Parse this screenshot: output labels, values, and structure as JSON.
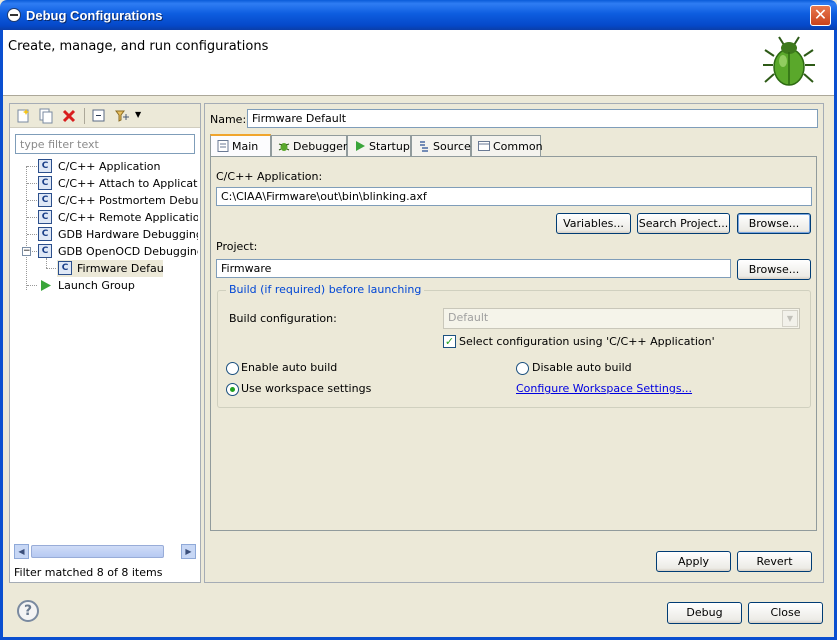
{
  "window": {
    "title": "Debug Configurations"
  },
  "header": {
    "heading": "Create, manage, and run configurations"
  },
  "left": {
    "filter_placeholder": "type filter text",
    "tree": [
      {
        "label": "C/C++ Application"
      },
      {
        "label": "C/C++ Attach to Application"
      },
      {
        "label": "C/C++ Postmortem Debugger"
      },
      {
        "label": "C/C++ Remote Application"
      },
      {
        "label": "GDB Hardware Debugging"
      },
      {
        "label": "GDB OpenOCD Debugging"
      },
      {
        "label": "Firmware Default"
      },
      {
        "label": "Launch Group"
      }
    ],
    "status": "Filter matched 8 of 8 items"
  },
  "config": {
    "name_label": "Name:",
    "name_value": "Firmware Default",
    "tabs": [
      {
        "label": "Main",
        "icon": "main-tab-icon"
      },
      {
        "label": "Debugger",
        "icon": "debugger-bug-icon"
      },
      {
        "label": "Startup",
        "icon": "startup-play-icon"
      },
      {
        "label": "Source",
        "icon": "source-icon"
      },
      {
        "label": "Common",
        "icon": "common-icon"
      }
    ],
    "app_label": "C/C++ Application:",
    "app_value": "C:\\CIAA\\Firmware\\out\\bin\\blinking.axf",
    "variables_btn": "Variables...",
    "search_project_btn": "Search Project...",
    "browse_btn": "Browse...",
    "project_label": "Project:",
    "project_value": "Firmware",
    "project_browse_btn": "Browse...",
    "build_group_title": "Build (if required) before launching",
    "build_config_label": "Build configuration:",
    "build_config_value": "Default",
    "select_config_label": "Select configuration using 'C/C++ Application'",
    "enable_auto_build": "Enable auto build",
    "disable_auto_build": "Disable auto build",
    "use_workspace": "Use workspace settings",
    "configure_link": "Configure Workspace Settings...",
    "apply_btn": "Apply",
    "revert_btn": "Revert"
  },
  "footer": {
    "debug_btn": "Debug",
    "close_btn": "Close"
  }
}
